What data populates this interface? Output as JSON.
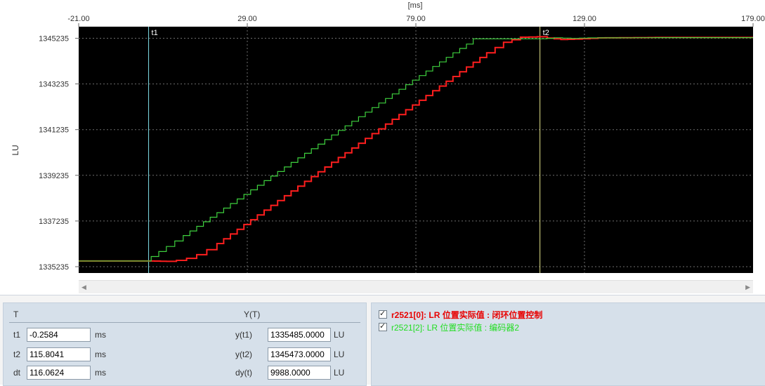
{
  "chart_data": {
    "type": "line",
    "xlabel": "[ms]",
    "ylabel": "LU",
    "xlim": [
      -21.0,
      179.0
    ],
    "ylim": [
      1335235,
      1345235
    ],
    "x_ticks": [
      "-21.00",
      "29.00",
      "79.00",
      "129.00",
      "179.00"
    ],
    "y_ticks": [
      "1345235",
      "1343235",
      "1341235",
      "1339235",
      "1337235",
      "1335235"
    ],
    "grid": true,
    "background": "#000000",
    "cursors": [
      {
        "name": "t1",
        "x": -0.2584,
        "color": "#7fe0e8"
      },
      {
        "name": "t2",
        "x": 115.8041,
        "color": "#e6e68c"
      }
    ],
    "series": [
      {
        "color": "#ff1e1e",
        "points": [
          [
            -21.0,
            1335485
          ],
          [
            -0.26,
            1335485
          ],
          [
            5,
            1335470
          ],
          [
            8,
            1335510
          ],
          [
            11,
            1335600
          ],
          [
            14,
            1335760
          ],
          [
            17,
            1335980
          ],
          [
            20,
            1336250
          ],
          [
            30,
            1337290
          ],
          [
            40,
            1338340
          ],
          [
            50,
            1339390
          ],
          [
            60,
            1340430
          ],
          [
            70,
            1341480
          ],
          [
            80,
            1342520
          ],
          [
            90,
            1343560
          ],
          [
            100,
            1344600
          ],
          [
            105,
            1345060
          ],
          [
            110,
            1345280
          ],
          [
            115,
            1345300
          ],
          [
            118,
            1345240
          ],
          [
            122,
            1345180
          ],
          [
            126,
            1345200
          ],
          [
            133,
            1345250
          ],
          [
            150,
            1345268
          ],
          [
            179,
            1345268
          ]
        ]
      },
      {
        "color": "#3ed13e",
        "points": [
          [
            -21.0,
            1335485
          ],
          [
            -0.26,
            1335485
          ],
          [
            0.5,
            1335680
          ],
          [
            5,
            1336120
          ],
          [
            10,
            1336600
          ],
          [
            20,
            1337600
          ],
          [
            30,
            1338600
          ],
          [
            40,
            1339600
          ],
          [
            50,
            1340600
          ],
          [
            60,
            1341600
          ],
          [
            70,
            1342600
          ],
          [
            80,
            1343600
          ],
          [
            90,
            1344600
          ],
          [
            94,
            1344980
          ],
          [
            96,
            1345210
          ],
          [
            115.8,
            1345210
          ],
          [
            120,
            1345255
          ],
          [
            125,
            1345230
          ],
          [
            130,
            1345250
          ],
          [
            150,
            1345262
          ],
          [
            179,
            1345262
          ]
        ]
      }
    ]
  },
  "measure": {
    "col_t_header": "T",
    "col_y_header": "Y(T)",
    "rows": [
      {
        "t_label": "t1",
        "t_value": "-0.2584",
        "t_unit": "ms",
        "y_label": "y(t1)",
        "y_value": "1335485.0000",
        "y_unit": "LU"
      },
      {
        "t_label": "t2",
        "t_value": "115.8041",
        "t_unit": "ms",
        "y_label": "y(t2)",
        "y_value": "1345473.0000",
        "y_unit": "LU"
      },
      {
        "t_label": "dt",
        "t_value": "116.0624",
        "t_unit": "ms",
        "y_label": "dy(t)",
        "y_value": "9988.0000",
        "y_unit": "LU"
      }
    ]
  },
  "legend": [
    {
      "label": "r2521[0]: LR 位置实际值 : 闭环位置控制",
      "color": "#e80000",
      "checked": true
    },
    {
      "label": "r2521[2]: LR 位置实际值 : 编码器2",
      "color": "#22dd22",
      "checked": true
    }
  ],
  "scrollbar": {
    "left_icon": "arrow-left-icon",
    "right_icon": "arrow-right-icon"
  }
}
